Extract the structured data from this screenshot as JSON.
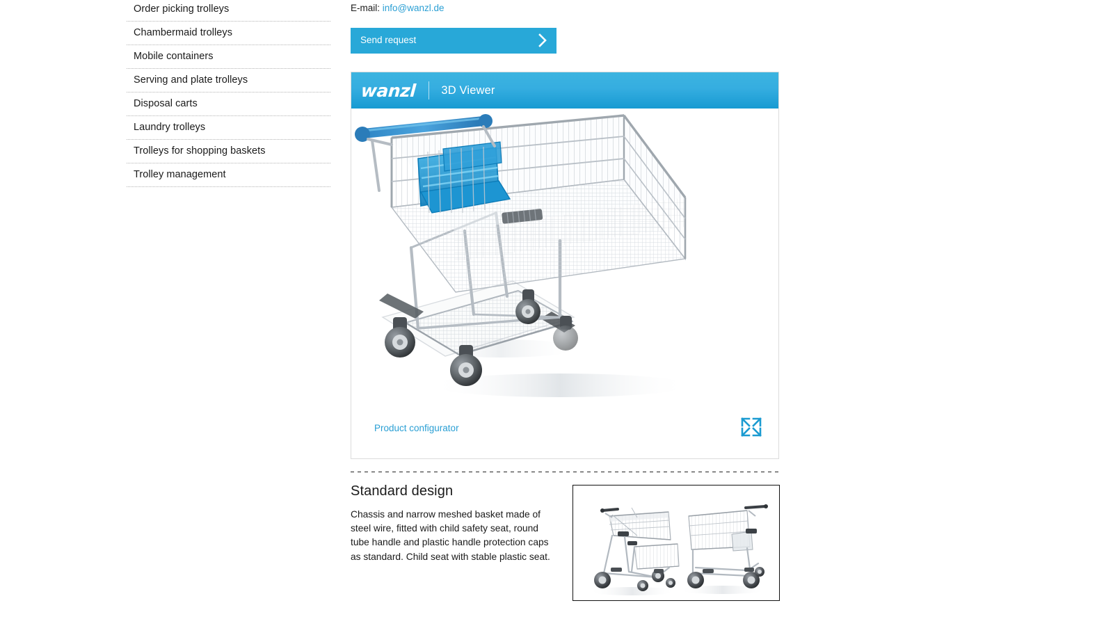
{
  "sidebar": {
    "items": [
      {
        "label": "Order picking trolleys"
      },
      {
        "label": "Chambermaid trolleys"
      },
      {
        "label": "Mobile containers"
      },
      {
        "label": "Serving and plate trolleys"
      },
      {
        "label": "Disposal carts"
      },
      {
        "label": "Laundry trolleys"
      },
      {
        "label": "Trolleys for shopping baskets"
      },
      {
        "label": "Trolley management"
      }
    ]
  },
  "contact": {
    "email_label": "E-mail:",
    "email_address": "info@wanzl.de"
  },
  "actions": {
    "send_request_label": "Send request"
  },
  "viewer": {
    "brand": "wanzl",
    "title": "3D Viewer",
    "configurator_link": "Product configurator",
    "expand_icon": "fullscreen-expand-icon",
    "product_alt": "Shopping trolley with blue handle and blue child safety seat"
  },
  "standard_design": {
    "heading": "Standard design",
    "body": "Chassis and narrow meshed basket made of steel wire, fitted with child safety seat, round tube handle and plastic handle protection caps as standard. Child seat with stable plastic seat.",
    "thumbnail_alt": "Two shopping trolleys side by side"
  },
  "colors": {
    "accent_blue": "#28a8d8",
    "link_blue": "#2a9fd4",
    "header_gradient_top": "#3cb4e0",
    "header_gradient_bottom": "#169ad2",
    "text": "#1a1a1a",
    "divider": "#b4b4b4",
    "trolley_handle_blue": "#2f86c5",
    "trolley_seat_blue": "#1f9bd6"
  }
}
